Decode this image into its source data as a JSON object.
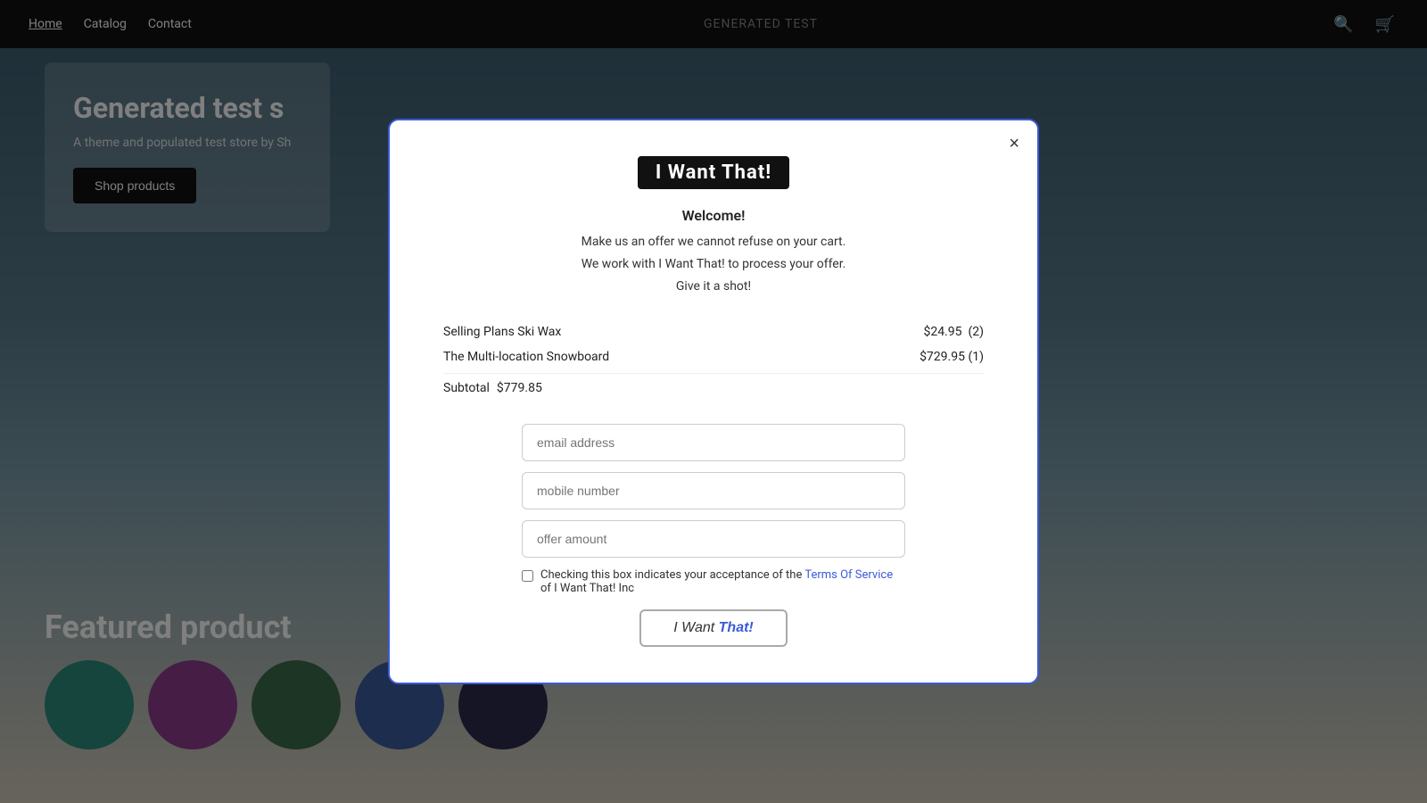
{
  "navbar": {
    "links": [
      {
        "label": "Home",
        "active": true
      },
      {
        "label": "Catalog",
        "active": false
      },
      {
        "label": "Contact",
        "active": false
      }
    ],
    "brand": "GENERATED TEST",
    "search_icon": "🔍",
    "cart_icon": "🛒"
  },
  "background": {
    "hero_title": "Generated test s",
    "hero_sub": "A theme and populated test store by Sh",
    "shop_btn": "Shop products",
    "featured_title": "Featured product"
  },
  "modal": {
    "logo_text": "I Want That!",
    "close_label": "×",
    "welcome": "Welcome!",
    "desc_line1": "Make us an offer we cannot refuse on your cart.",
    "desc_line2": "We work with I Want That! to process your offer.",
    "desc_line3": "Give it a shot!",
    "items": [
      {
        "name": "Selling Plans Ski Wax",
        "price": "$24.95",
        "qty": "(2)"
      },
      {
        "name": "The Multi-location Snowboard",
        "price": "$729.95",
        "qty": "(1)"
      }
    ],
    "subtotal_label": "Subtotal",
    "subtotal_value": "$779.85",
    "email_placeholder": "email address",
    "mobile_placeholder": "mobile number",
    "offer_placeholder": "offer amount",
    "checkbox_text_before": "Checking this box indicates your acceptance of the",
    "checkbox_tos_link": "Terms Of Service",
    "checkbox_text_after": "of I Want That! Inc",
    "submit_label_normal": "I Want ",
    "submit_label_bold": "That!"
  },
  "product_circles": [
    {
      "color": "#2a8a7a"
    },
    {
      "color": "#8a3a8a"
    },
    {
      "color": "#3a6a4a"
    },
    {
      "color": "#3a5a9a"
    },
    {
      "color": "#2a2a4a"
    }
  ]
}
